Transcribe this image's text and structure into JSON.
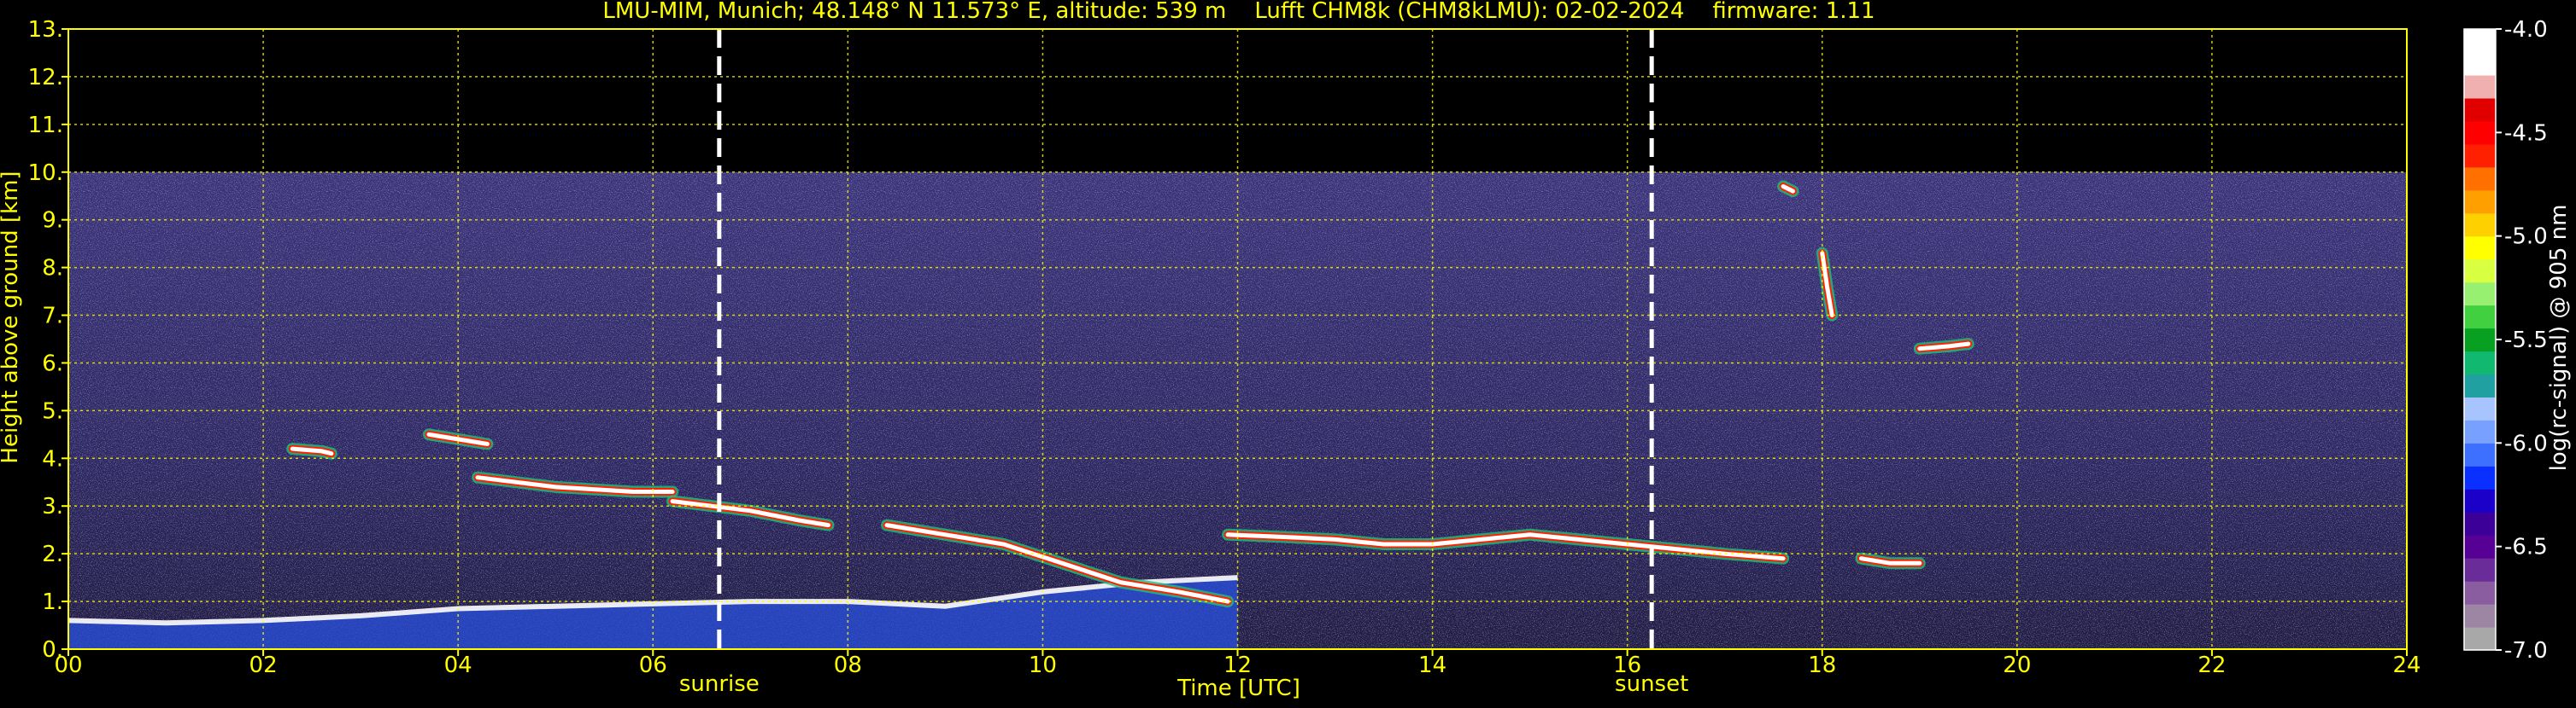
{
  "chart_data": {
    "type": "heatmap",
    "title": "LMU-MIM, Munich; 48.148° N 11.573° E, altitude: 539 m    Lufft CHM8k (CHM8kLMU): 02-02-2024    firmware: 1.11",
    "xlabel": "Time [UTC]",
    "ylabel": "Height above ground [km]",
    "xlim": [
      0,
      24
    ],
    "ylim": [
      0,
      13
    ],
    "x_ticks": [
      0,
      2,
      4,
      6,
      8,
      10,
      12,
      14,
      16,
      18,
      20,
      22,
      24
    ],
    "x_tick_labels": [
      "00",
      "02",
      "04",
      "06",
      "08",
      "10",
      "12",
      "14",
      "16",
      "18",
      "20",
      "22",
      "24"
    ],
    "y_ticks": [
      0,
      1,
      2,
      3,
      4,
      5,
      6,
      7,
      8,
      9,
      10,
      11,
      12,
      13
    ],
    "y_tick_labels": [
      "0.",
      "1.",
      "2.",
      "3.",
      "4.",
      "5.",
      "6.",
      "7.",
      "8.",
      "9.",
      "10.",
      "11.",
      "12.",
      "13."
    ],
    "grid": true,
    "data_top_km": 10,
    "markers": [
      {
        "name": "sunrise",
        "x": 6.68
      },
      {
        "name": "sunset",
        "x": 16.25
      }
    ],
    "colorbar": {
      "label": "log(rc-signal) @ 905 nm",
      "range": [
        -7.0,
        -4.0
      ],
      "ticks": [
        -4.0,
        -4.5,
        -5.0,
        -5.5,
        -6.0,
        -6.5,
        -7.0
      ],
      "tick_labels": [
        "-4.0",
        "-4.5",
        "-5.0",
        "-5.5",
        "-6.0",
        "-6.5",
        "-7.0"
      ],
      "colors": [
        "#a8a8a8",
        "#9c86a4",
        "#8a5ca0",
        "#6a2c98",
        "#560096",
        "#3c0098",
        "#1a00c8",
        "#0a30ff",
        "#3e70ff",
        "#78a0ff",
        "#a8c4ff",
        "#20a0a0",
        "#10b870",
        "#08a020",
        "#40d040",
        "#98f070",
        "#d8ff40",
        "#ffff00",
        "#ffd000",
        "#ffa000",
        "#ff7000",
        "#ff2000",
        "#ff0000",
        "#e00000",
        "#f0b0b0",
        "#ffffff",
        "#ffffff"
      ]
    },
    "features": [
      {
        "kind": "boundary_layer",
        "x": [
          0,
          1,
          2,
          3,
          4,
          5,
          6,
          7,
          8,
          9,
          10,
          11,
          12
        ],
        "y": [
          0.6,
          0.55,
          0.6,
          0.7,
          0.85,
          0.9,
          0.95,
          1.0,
          1.0,
          0.9,
          1.2,
          1.4,
          1.5
        ]
      },
      {
        "kind": "cloud_layer",
        "x": [
          2.3,
          2.6,
          2.7
        ],
        "y": [
          4.2,
          4.15,
          4.1
        ]
      },
      {
        "kind": "cloud_layer",
        "x": [
          3.7,
          4.0,
          4.3
        ],
        "y": [
          4.5,
          4.4,
          4.3
        ]
      },
      {
        "kind": "cloud_layer",
        "x": [
          4.2,
          5.0,
          5.8,
          6.2
        ],
        "y": [
          3.6,
          3.4,
          3.3,
          3.3
        ]
      },
      {
        "kind": "cloud_layer",
        "x": [
          6.2,
          6.6,
          7.0,
          7.5,
          7.8
        ],
        "y": [
          3.1,
          3.0,
          2.9,
          2.7,
          2.6
        ]
      },
      {
        "kind": "cloud_layer",
        "x": [
          8.4,
          9.0,
          9.6,
          10.2,
          10.8,
          11.4,
          11.9
        ],
        "y": [
          2.6,
          2.4,
          2.2,
          1.8,
          1.4,
          1.2,
          1.0
        ]
      },
      {
        "kind": "cloud_layer",
        "x": [
          11.9,
          12.5,
          13.0,
          13.5,
          14.0,
          14.5,
          15.0,
          15.5,
          16.0,
          16.5,
          17.0,
          17.6
        ],
        "y": [
          2.4,
          2.35,
          2.3,
          2.2,
          2.2,
          2.3,
          2.4,
          2.3,
          2.2,
          2.1,
          2.0,
          1.9
        ]
      },
      {
        "kind": "cloud_layer",
        "x": [
          18.4,
          18.7,
          19.0
        ],
        "y": [
          1.9,
          1.8,
          1.8
        ]
      },
      {
        "kind": "cloud_layer",
        "x": [
          19.0,
          19.3,
          19.5
        ],
        "y": [
          6.3,
          6.35,
          6.4
        ]
      },
      {
        "kind": "cloud_layer",
        "x": [
          18.0,
          18.05,
          18.1
        ],
        "y": [
          8.3,
          7.6,
          7.0
        ]
      },
      {
        "kind": "cloud_layer",
        "x": [
          17.6,
          17.7
        ],
        "y": [
          9.7,
          9.6
        ]
      }
    ]
  }
}
